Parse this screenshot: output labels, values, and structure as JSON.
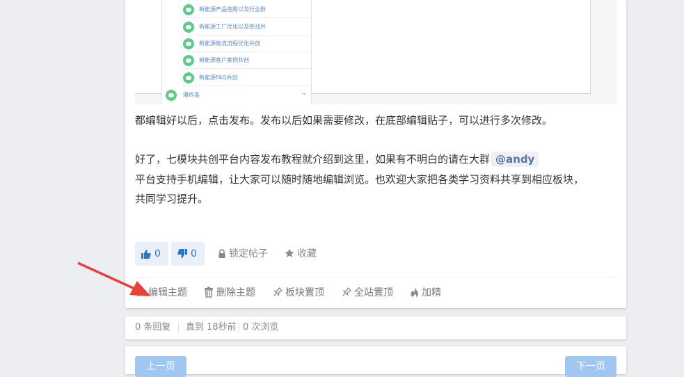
{
  "embed_menu": {
    "items": [
      "新能源产品使用以及行业群",
      "新能源工厂优化以及密战共",
      "新能源物流流程优化共创",
      "新能源客户案例共创",
      "新能源FAQ共创"
    ],
    "parent_label": "爆炸盖",
    "chevron": "⌄"
  },
  "post": {
    "para1": "都编辑好以后，点击发布。发布以后如果需要修改，在底部编辑贴子，可以进行多次修改。",
    "para2_text": "好了，七模块共创平台内容发布教程就介绍到这里，如果有不明白的请在大群",
    "mention": "@andy",
    "para3": "平台支持手机编辑，让大家可以随时随地编辑浏览。也欢迎大家把各类学习资料共享到相应板块，",
    "para4": "共同学习提升。"
  },
  "votes": {
    "up_count": "0",
    "down_count": "0"
  },
  "actions": {
    "lock": "锁定帖子",
    "favorite": "收藏"
  },
  "toolbar": {
    "edit": "编辑主题",
    "delete": "删除主题",
    "pin_board": "板块置顶",
    "pin_site": "全站置顶",
    "feature": "加精"
  },
  "stats": {
    "replies": "0 条回复",
    "last": "直到 18秒前",
    "views": "0 次浏览"
  },
  "pager": {
    "prev": "上一页",
    "next": "下一页"
  },
  "icons": {
    "thumbs_up": "thumbs-up-icon",
    "thumbs_down": "thumbs-down-icon",
    "lock": "lock-icon",
    "star": "star-icon",
    "edit": "edit-icon",
    "trash": "trash-icon",
    "pin": "pin-icon",
    "fire": "fire-icon"
  },
  "colors": {
    "accent": "#2d75c6",
    "vote_bg": "#e9f0f9",
    "arrow": "#e8413c",
    "menu_dot": "#5ecb87",
    "pager_btn": "#9fc7ef"
  }
}
